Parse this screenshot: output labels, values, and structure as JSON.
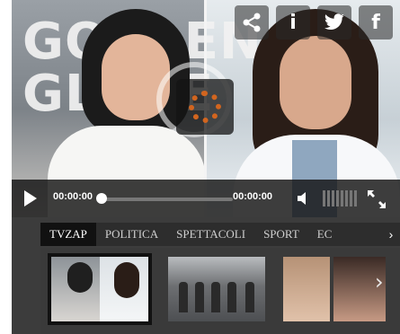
{
  "video": {
    "background_text": "GOLDEN GLOBE",
    "current_time": "00:00:00",
    "duration": "00:00:00",
    "progress": 0.0
  },
  "share": {
    "buttons": [
      {
        "name": "share-icon",
        "glyph": "⤧"
      },
      {
        "name": "info-icon",
        "glyph": "i"
      },
      {
        "name": "twitter-icon",
        "glyph": "t"
      },
      {
        "name": "facebook-icon",
        "glyph": "f"
      }
    ]
  },
  "tabs": [
    "TVZAP",
    "POLITICA",
    "SPETTACOLI",
    "SPORT",
    "EC"
  ],
  "active_tab": 0,
  "tabs_arrow": "›",
  "strip_arrow": "›",
  "colors": {
    "player_bg": "#3c3c3c",
    "spinner": "#d2651f",
    "active_tab_bg": "#111111"
  }
}
